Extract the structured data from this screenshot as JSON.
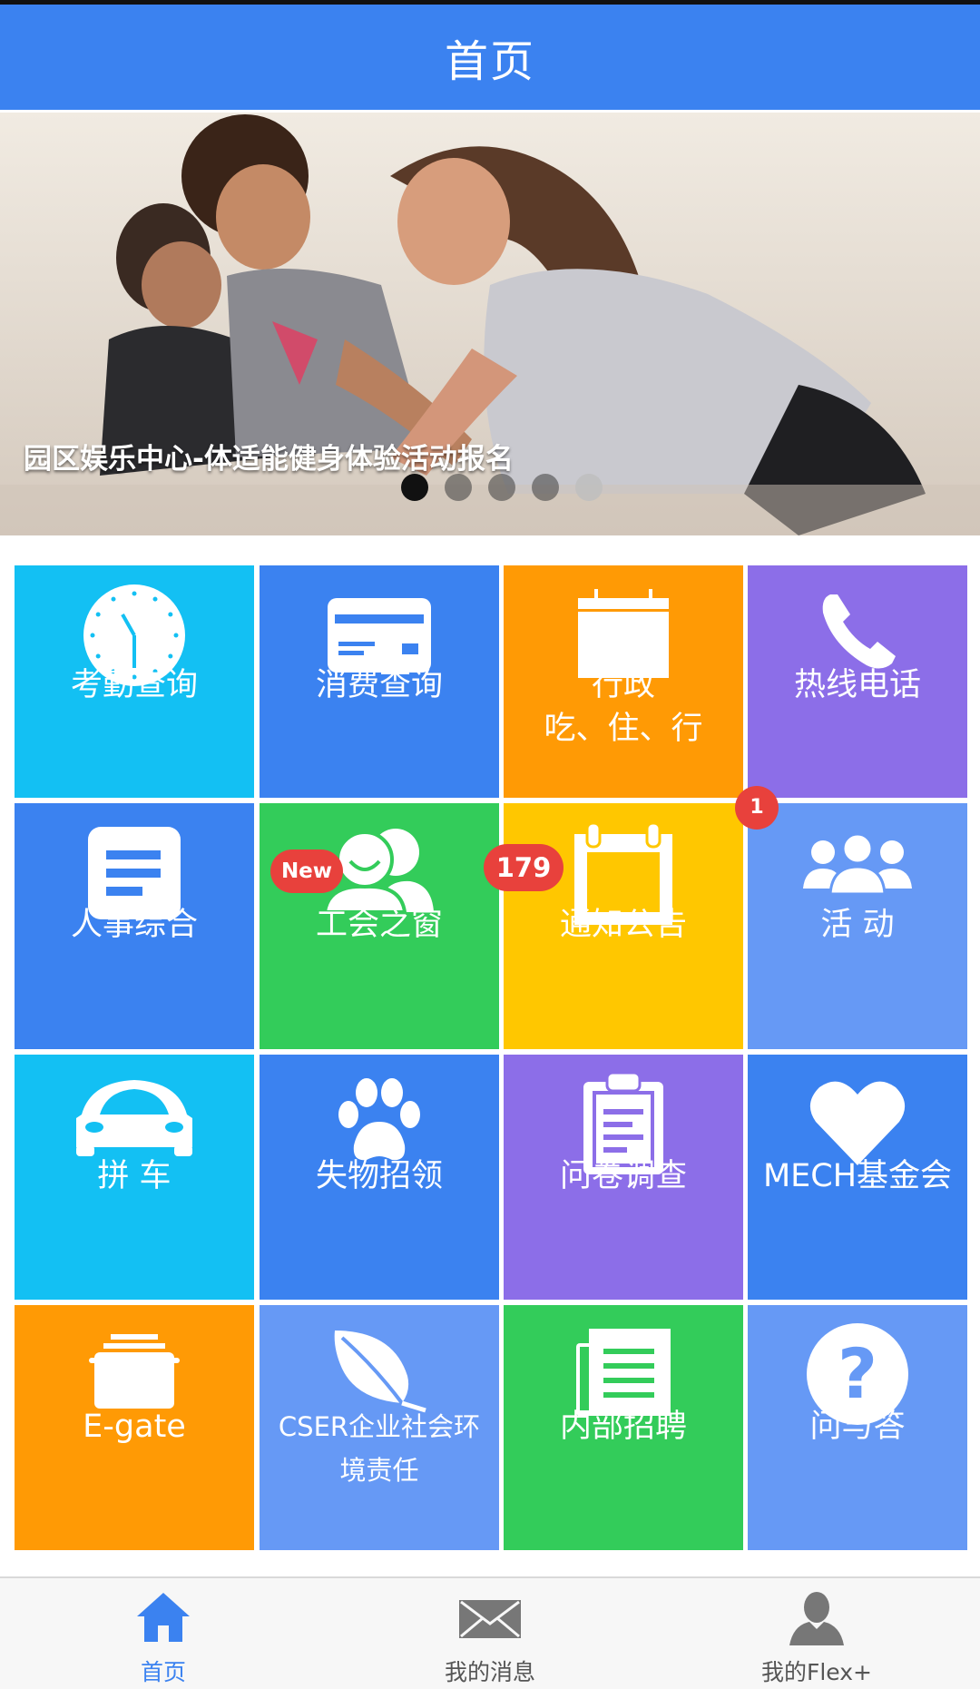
{
  "header": {
    "title": "首页"
  },
  "banner": {
    "caption": "园区娱乐中心-体适能健身体验活动报名",
    "slide_count": 5,
    "active_slide": 1
  },
  "tiles": [
    {
      "label": "考勤查询",
      "icon": "clock-icon",
      "color": "#13c0f3"
    },
    {
      "label": "消费查询",
      "icon": "card-icon",
      "color": "#3b82f0"
    },
    {
      "label": "行政",
      "label2": "吃、住、行",
      "icon": "calendar-icon",
      "color": "#ff9a05"
    },
    {
      "label": "热线电话",
      "icon": "phone-icon",
      "color": "#8c6ee8"
    },
    {
      "label": "人事综合",
      "icon": "document-icon",
      "color": "#3b82f0"
    },
    {
      "label": "工会之窗",
      "icon": "users-chat-icon",
      "color": "#33cc5a",
      "badge": "New"
    },
    {
      "label": "通知公告",
      "icon": "notice-calendar-icon",
      "color": "#ffc700",
      "badge": "179"
    },
    {
      "label": "活 动",
      "icon": "group-icon",
      "color": "#6699f5",
      "badge": "1"
    },
    {
      "label": "拼 车",
      "icon": "car-icon",
      "color": "#13c0f3"
    },
    {
      "label": "失物招领",
      "icon": "paw-icon",
      "color": "#3b82f0"
    },
    {
      "label": "问卷调查",
      "icon": "clipboard-icon",
      "color": "#8c6ee8"
    },
    {
      "label": "MECH基金会",
      "icon": "heart-icon",
      "color": "#3b82f0"
    },
    {
      "label": "E-gate",
      "icon": "folder-icon",
      "color": "#ff9a05"
    },
    {
      "label": "CSER企业社会环",
      "label2": "境责任",
      "icon": "leaf-icon",
      "color": "#6699f5"
    },
    {
      "label": "内部招聘",
      "icon": "newspaper-icon",
      "color": "#33cc5a"
    },
    {
      "label": "问与答",
      "icon": "question-icon",
      "color": "#6699f5"
    }
  ],
  "tabbar": {
    "items": [
      {
        "label": "首页",
        "icon": "home-icon",
        "active": true
      },
      {
        "label": "我的消息",
        "icon": "mail-icon",
        "active": false
      },
      {
        "label": "我的Flex+",
        "icon": "person-icon",
        "active": false
      }
    ],
    "active_color": "#3b82f0",
    "inactive_color": "#777777"
  }
}
